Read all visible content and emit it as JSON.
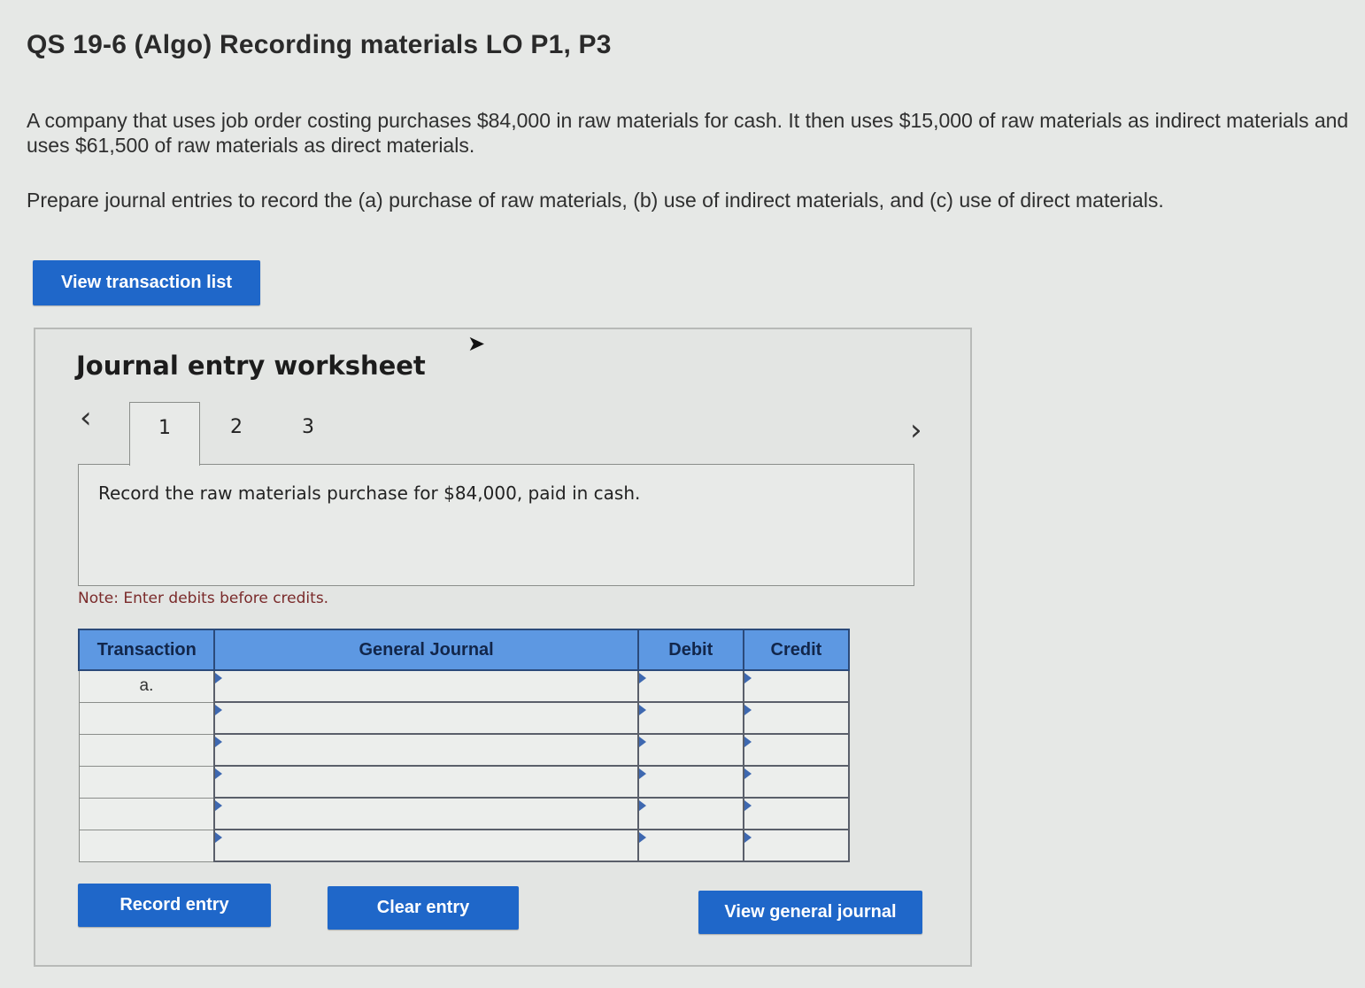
{
  "header": {
    "title": "QS 19-6 (Algo) Recording materials LO P1, P3"
  },
  "problem": {
    "paragraph_1": "A company that uses job order costing purchases $84,000 in raw materials for cash. It then uses $15,000 of raw materials as indirect materials and uses $61,500 of raw materials as direct materials.",
    "paragraph_2": "Prepare journal entries to record the (a) purchase of raw materials, (b) use of indirect materials, and (c) use of direct materials."
  },
  "buttons": {
    "view_transaction_list": "View transaction list",
    "record_entry": "Record entry",
    "clear_entry": "Clear entry",
    "view_general_journal": "View general journal"
  },
  "worksheet": {
    "title": "Journal entry worksheet",
    "nav_prev_icon": "chevron-left-icon",
    "nav_next_icon": "chevron-right-icon",
    "tabs": [
      {
        "label": "1",
        "active": true
      },
      {
        "label": "2",
        "active": false
      },
      {
        "label": "3",
        "active": false
      }
    ],
    "prompt": "Record the raw materials purchase for $84,000, paid in cash.",
    "note": "Note: Enter debits before credits."
  },
  "journal_table": {
    "columns": [
      "Transaction",
      "General Journal",
      "Debit",
      "Credit"
    ],
    "rows": [
      {
        "transaction": "a.",
        "account": "",
        "debit": "",
        "credit": ""
      },
      {
        "transaction": "",
        "account": "",
        "debit": "",
        "credit": ""
      },
      {
        "transaction": "",
        "account": "",
        "debit": "",
        "credit": ""
      },
      {
        "transaction": "",
        "account": "",
        "debit": "",
        "credit": ""
      },
      {
        "transaction": "",
        "account": "",
        "debit": "",
        "credit": ""
      },
      {
        "transaction": "",
        "account": "",
        "debit": "",
        "credit": ""
      }
    ]
  },
  "colors": {
    "button_blue": "#1f67c9",
    "table_header_blue": "#5d98e2",
    "note_text": "#7a2a2a"
  }
}
